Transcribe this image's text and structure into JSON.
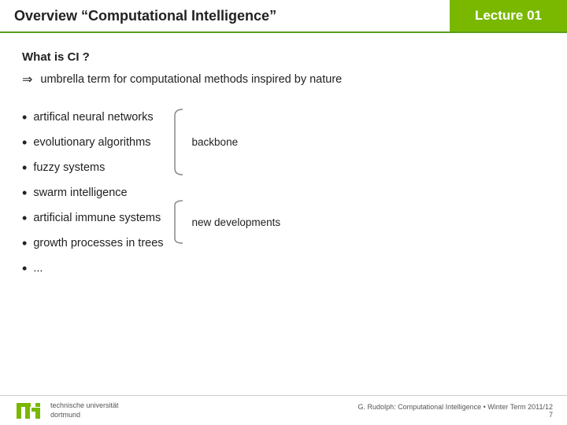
{
  "header": {
    "title": "Overview “Computational Intelligence”",
    "lecture_label": "Lecture 01"
  },
  "slide": {
    "what_is_label": "What is CI ?",
    "umbrella_arrow": "⇒",
    "umbrella_text": "umbrella term for computational methods inspired by nature",
    "bullets": [
      {
        "text": "artifical neural networks"
      },
      {
        "text": "evolutionary algorithms"
      },
      {
        "text": "fuzzy systems"
      },
      {
        "text": "swarm intelligence"
      },
      {
        "text": "artificial immune systems"
      },
      {
        "text": "growth processes in trees"
      },
      {
        "text": "..."
      }
    ],
    "backbone_label": "backbone",
    "new_dev_label": "new developments"
  },
  "footer": {
    "uni_line1": "technische universität",
    "uni_line2": "dortmund",
    "citation": "G. Rudolph: Computational Intelligence • Winter Term 2011/12",
    "page_number": "7"
  }
}
